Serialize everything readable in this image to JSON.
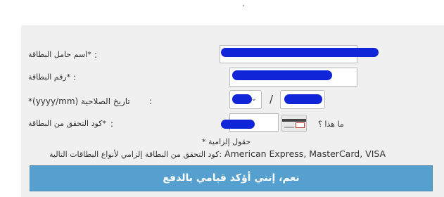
{
  "top_mark": ".",
  "form": {
    "cardholder_name": {
      "label": "*اسم حامل البطاقة",
      "value": ""
    },
    "card_number": {
      "label": "*رقم البطاقة",
      "value": ""
    },
    "expiry": {
      "label": "تاريخ الصلاحية (yyyy/mm)*",
      "month": "",
      "year": "",
      "separator": "/"
    },
    "cvv": {
      "label": "*كود التحقق من البطاقة",
      "value": ""
    },
    "colon": ":",
    "what_is_this": "ما هذا ؟",
    "required_note": "حقول إلزامية *",
    "cvv_note_ar": "كود التحقق من البطاقة إلزامي لأنواع البطاقات التالية:",
    "cvv_note_cards": "American Express, MasterCard, VISA"
  },
  "pay_button": {
    "label": "نعم، إنني أؤكد قيامي بالدفع"
  },
  "colors": {
    "button": "#56a0cf",
    "panel": "#f0f0f0",
    "redaction": "#1024d8"
  },
  "icons": [
    "chevron-down-icon",
    "card-cvv-icon"
  ]
}
